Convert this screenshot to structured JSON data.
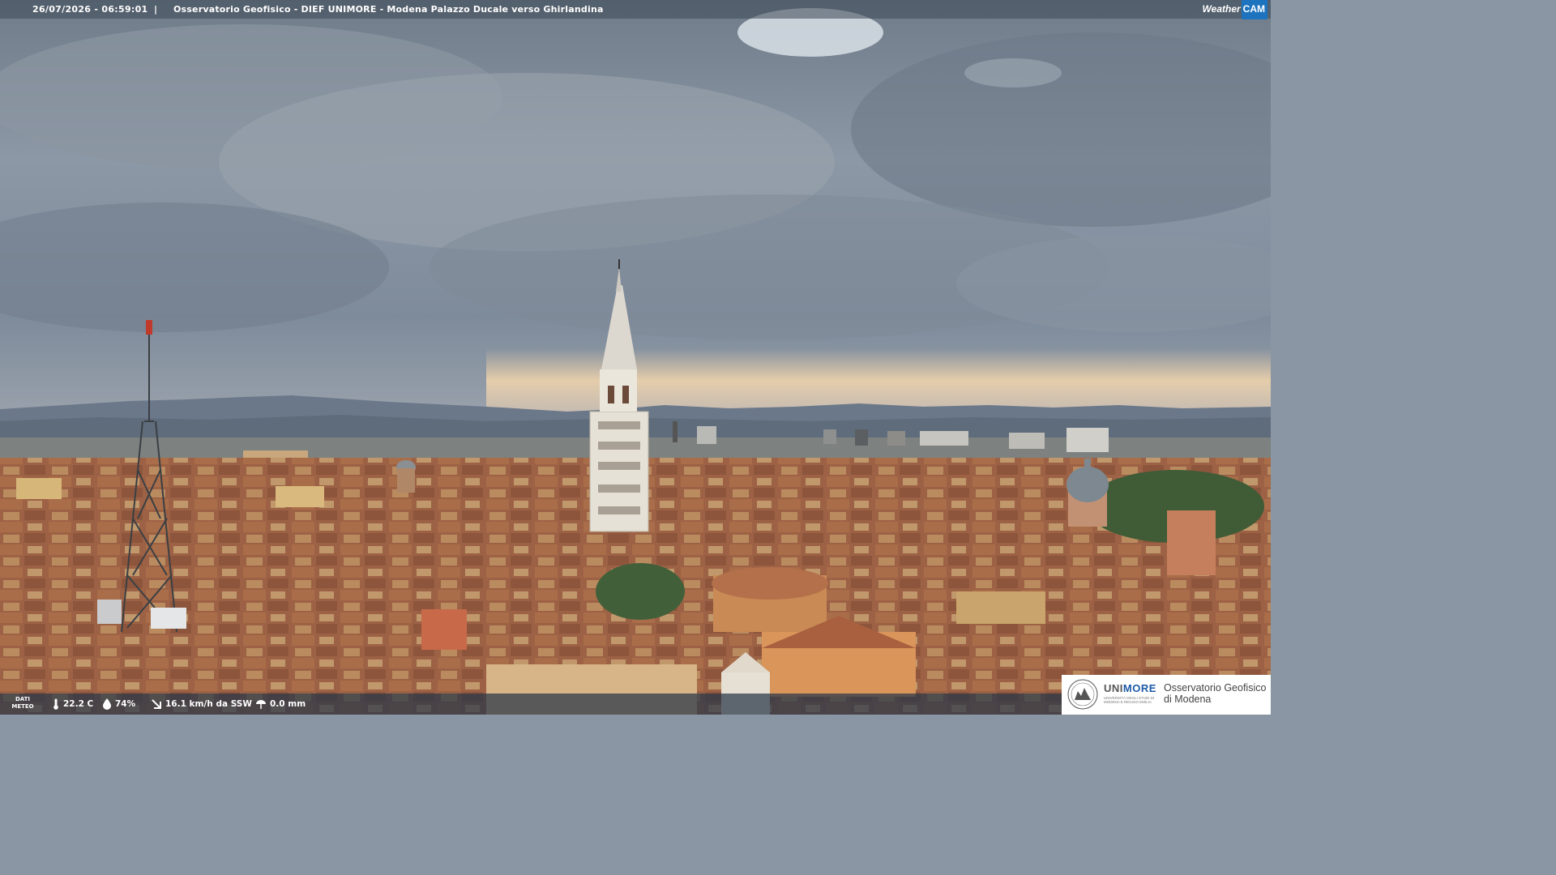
{
  "overlay": {
    "datetime": "26/07/2026 - 06:59:01",
    "separator": "|",
    "title": "Osservatorio Geofisico - DIEF UNIMORE - Modena Palazzo Ducale verso Ghirlandina",
    "brand_left": "Weather",
    "brand_right": "CAM"
  },
  "weather": {
    "label_line1": "DATI",
    "label_line2": "METEO",
    "temperature": "22.2 C",
    "humidity": "74%",
    "wind": "16.1 km/h da SSW",
    "rain": "0.0 mm",
    "icons": [
      "thermometer-icon",
      "humidity-drop-icon",
      "wind-icon",
      "rain-icon"
    ]
  },
  "logo": {
    "uni_part1": "UNI",
    "uni_part2": "MORE",
    "uni_sub1": "UNIVERSITÀ DEGLI STUDI DI",
    "uni_sub2": "MODENA E REGGIO EMILIA",
    "observatory_line1": "Osservatorio Geofisico",
    "observatory_line2": "di Modena"
  },
  "colors": {
    "sky": "#7d8a99",
    "sunset": "#f0d2a8",
    "roofs": "#a86a4a",
    "accent_blue": "#1e73be"
  }
}
